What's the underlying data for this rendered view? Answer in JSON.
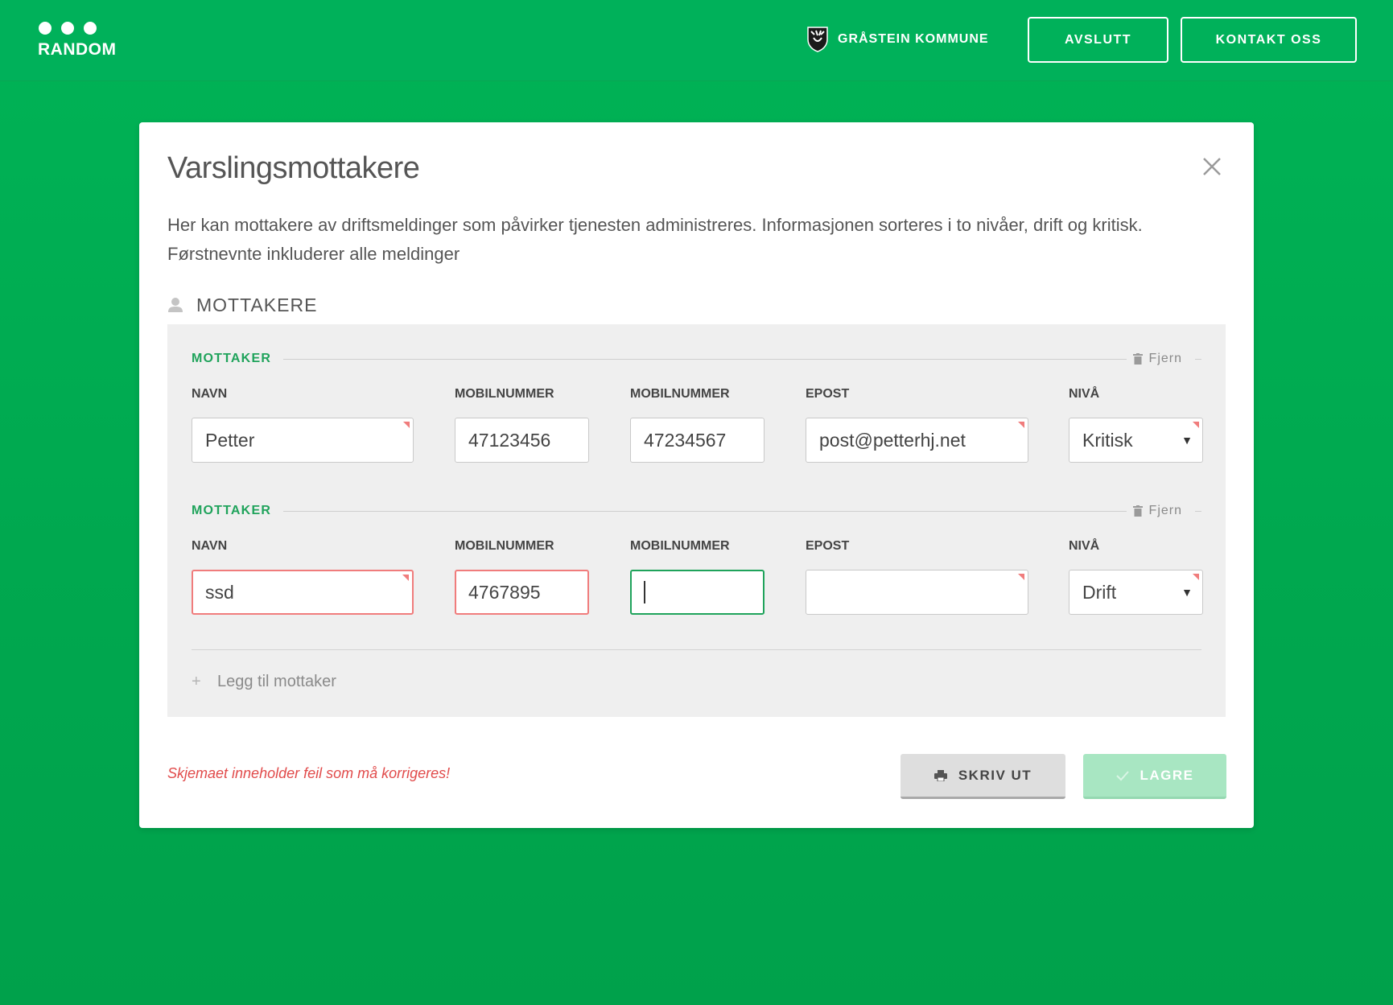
{
  "header": {
    "logo_text": "RANDOM",
    "kommune_name": "GRÅSTEIN KOMMUNE",
    "buttons": {
      "avslutt": "AVSLUTT",
      "kontakt": "KONTAKT OSS"
    }
  },
  "modal": {
    "title": "Varslingsmottakere",
    "description": "Her kan mottakere av driftsmeldinger som påvirker tjenesten administreres. Informasjonen sorteres i to nivåer, drift og kritisk. Førstnevnte inkluderer alle meldinger",
    "section_title": "MOTTAKERE",
    "recipients": [
      {
        "title": "MOTTAKER",
        "remove_label": "Fjern",
        "fields": {
          "navn": {
            "label": "NAVN",
            "value": "Petter"
          },
          "mobil1": {
            "label": "MOBILNUMMER",
            "value": "47123456"
          },
          "mobil2": {
            "label": "MOBILNUMMER",
            "value": "47234567"
          },
          "epost": {
            "label": "EPOST",
            "value": "post@petterhj.net"
          },
          "niva": {
            "label": "NIVÅ",
            "value": "Kritisk"
          }
        }
      },
      {
        "title": "MOTTAKER",
        "remove_label": "Fjern",
        "fields": {
          "navn": {
            "label": "NAVN",
            "value": "ssd"
          },
          "mobil1": {
            "label": "MOBILNUMMER",
            "value": "4767895"
          },
          "mobil2": {
            "label": "MOBILNUMMER",
            "value": ""
          },
          "epost": {
            "label": "EPOST",
            "value": ""
          },
          "niva": {
            "label": "NIVÅ",
            "value": "Drift"
          }
        }
      }
    ],
    "add_recipient_label": "Legg til mottaker",
    "error_message": "Skjemaet inneholder feil som må korrigeres!",
    "buttons": {
      "print": "SKRIV UT",
      "save": "LAGRE"
    }
  },
  "icons": {
    "logo": "three-dots-logo-icon",
    "crest": "kommune-crest-icon",
    "close": "close-icon",
    "user": "user-icon",
    "trash": "trash-icon",
    "plus": "plus-icon",
    "print": "printer-icon",
    "check": "check-icon",
    "select_arrow": "triangle-down-icon"
  },
  "colors": {
    "brand_green": "#00b15a",
    "accent_green": "#1fa35b",
    "error_red": "#f07c7c",
    "save_disabled": "#a8e6c2"
  }
}
